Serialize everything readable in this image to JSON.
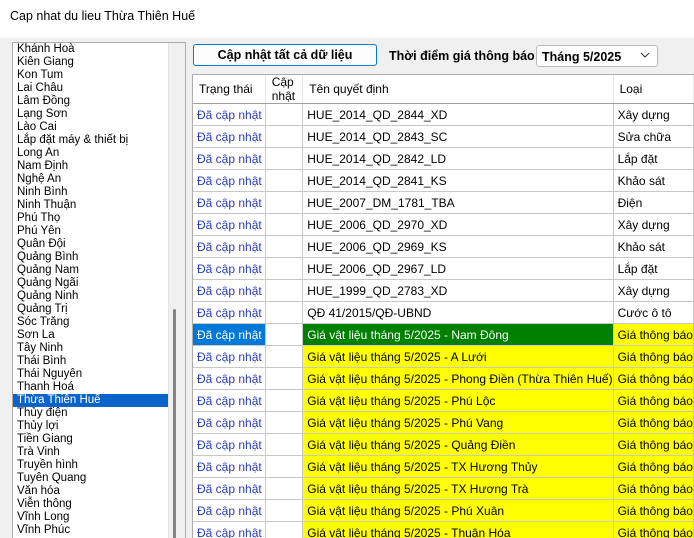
{
  "window": {
    "title": "Cap nhat du lieu Thừa Thiên Huế"
  },
  "left_list": {
    "items": [
      "Khánh Hoà",
      "Kiên Giang",
      "Kon Tum",
      "Lai Châu",
      "Lâm Đồng",
      "Lạng Sơn",
      "Lào Cai",
      "Lắp đặt máy & thiết bị",
      "Long An",
      "Nam Định",
      "Nghệ An",
      "Ninh Bình",
      "Ninh Thuận",
      "Phú Thọ",
      "Phú Yên",
      "Quân Đội",
      "Quảng Bình",
      "Quảng Nam",
      "Quảng Ngãi",
      "Quảng Ninh",
      "Quảng Trị",
      "Sóc Trăng",
      "Sơn La",
      "Tây Ninh",
      "Thái Bình",
      "Thái Nguyên",
      "Thanh Hoá",
      "Thừa Thiên Huế",
      "Thủy điện",
      "Thủy lợi",
      "Tiền Giang",
      "Trà Vinh",
      "Truyền hình",
      "Tuyên Quang",
      "Văn hóa",
      "Viễn thông",
      "Vĩnh Long",
      "Vĩnh Phúc"
    ],
    "selected": "Thừa Thiên Huế"
  },
  "toolbar": {
    "update_all_label": "Cập nhật tất cả dữ liệu",
    "time_label": "Thời điểm giá thông báo",
    "time_value": "Tháng 5/2025"
  },
  "grid": {
    "columns": [
      "Trạng thái",
      "Cập nhật",
      "Tên quyết định",
      "Loại"
    ],
    "rows": [
      {
        "status": "Đã cập nhật",
        "update": "",
        "name": "HUE_2014_QD_2844_XD",
        "type": "Xây dựng"
      },
      {
        "status": "Đã cập nhật",
        "update": "",
        "name": "HUE_2014_QD_2843_SC",
        "type": "Sửa chữa"
      },
      {
        "status": "Đã cập nhật",
        "update": "",
        "name": "HUE_2014_QD_2842_LD",
        "type": "Lắp đặt"
      },
      {
        "status": "Đã cập nhật",
        "update": "",
        "name": "HUE_2014_QD_2841_KS",
        "type": "Khảo sát"
      },
      {
        "status": "Đã cập nhật",
        "update": "",
        "name": "HUE_2007_DM_1781_TBA",
        "type": "Điện"
      },
      {
        "status": "Đã cập nhật",
        "update": "",
        "name": "HUE_2006_QD_2970_XD",
        "type": "Xây dựng"
      },
      {
        "status": "Đã cập nhật",
        "update": "",
        "name": "HUE_2006_QD_2969_KS",
        "type": "Khảo sát"
      },
      {
        "status": "Đã cập nhật",
        "update": "",
        "name": "HUE_2006_QD_2967_LD",
        "type": "Lắp đặt"
      },
      {
        "status": "Đã cập nhật",
        "update": "",
        "name": "HUE_1999_QD_2783_XD",
        "type": "Xây dựng"
      },
      {
        "status": "Đã cập nhật",
        "update": "",
        "name": "QĐ 41/2015/QĐ-UBND",
        "type": "Cước ô tô"
      },
      {
        "status": "Đã cập nhật",
        "update": "",
        "name": "Giá vật liệu tháng 5/2025 - Nam Đông",
        "type": "Giá thông báo",
        "style": "active"
      },
      {
        "status": "Đã cập nhật",
        "update": "",
        "name": "Giá vật liệu tháng 5/2025 - A Lưới",
        "type": "Giá thông báo",
        "style": "yellow"
      },
      {
        "status": "Đã cập nhật",
        "update": "",
        "name": "Giá vật liệu tháng 5/2025 - Phong Điền (Thừa Thiên Huế)",
        "type": "Giá thông báo",
        "style": "yellow"
      },
      {
        "status": "Đã cập nhật",
        "update": "",
        "name": "Giá vật liệu tháng 5/2025 - Phú Lộc",
        "type": "Giá thông báo",
        "style": "yellow"
      },
      {
        "status": "Đã cập nhật",
        "update": "",
        "name": "Giá vật liệu tháng 5/2025 - Phú Vang",
        "type": "Giá thông báo",
        "style": "yellow"
      },
      {
        "status": "Đã cập nhật",
        "update": "",
        "name": "Giá vật liệu tháng 5/2025 - Quảng Điền",
        "type": "Giá thông báo",
        "style": "yellow"
      },
      {
        "status": "Đã cập nhật",
        "update": "",
        "name": "Giá vật liệu tháng 5/2025 - TX Hương Thủy",
        "type": "Giá thông báo",
        "style": "yellow"
      },
      {
        "status": "Đã cập nhật",
        "update": "",
        "name": "Giá vật liệu tháng 5/2025 - TX Hương Trà",
        "type": "Giá thông báo",
        "style": "yellow"
      },
      {
        "status": "Đã cập nhật",
        "update": "",
        "name": "Giá vật liệu tháng 5/2025 - Phú Xuân",
        "type": "Giá thông báo",
        "style": "yellow"
      },
      {
        "status": "Đã cập nhật",
        "update": "",
        "name": "Giá vật liệu tháng 5/2025 - Thuận Hóa",
        "type": "Giá thông báo",
        "style": "yellow"
      }
    ]
  },
  "colors": {
    "highlight": "#ffff00",
    "active_name": "#008000",
    "selection": "#0078d7",
    "status_text": "#2a3bb5"
  },
  "icons": {
    "dropdown": "chevron-down-icon"
  }
}
